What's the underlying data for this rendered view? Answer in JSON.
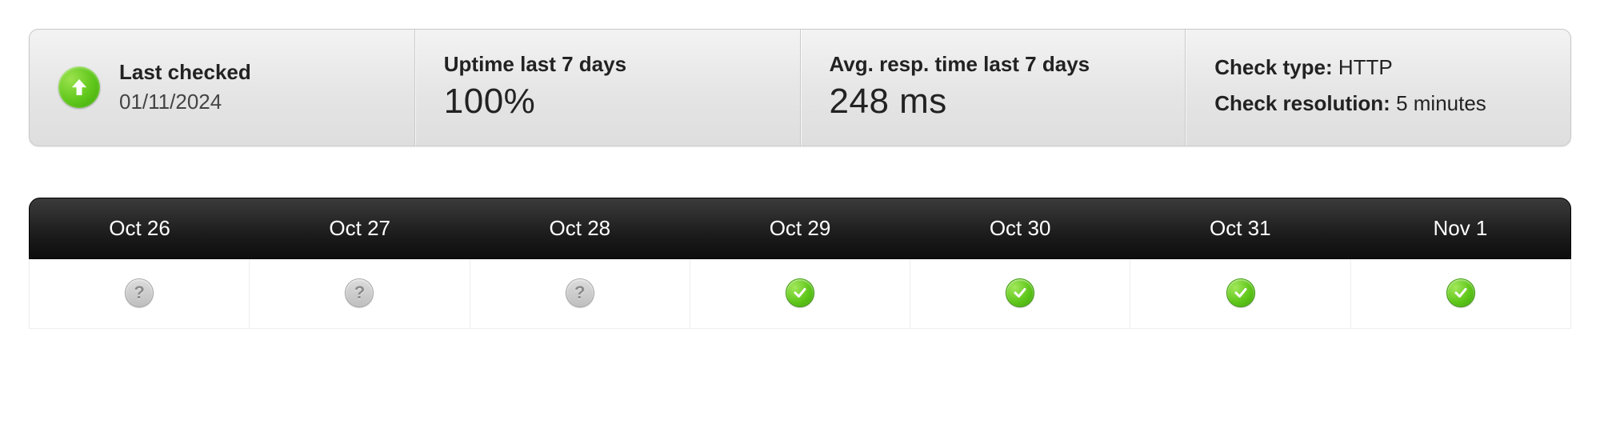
{
  "summary": {
    "last_checked_label": "Last checked",
    "last_checked_value": "01/11/2024",
    "uptime_label": "Uptime last 7 days",
    "uptime_value": "100%",
    "resp_label": "Avg. resp. time last 7 days",
    "resp_value": "248 ms",
    "check_type_label": "Check type:",
    "check_type_value": "HTTP",
    "check_res_label": "Check resolution:",
    "check_res_value": "5 minutes",
    "status_icon": "up-arrow-icon"
  },
  "history": {
    "days": [
      {
        "label": "Oct 26",
        "status": "unknown"
      },
      {
        "label": "Oct 27",
        "status": "unknown"
      },
      {
        "label": "Oct 28",
        "status": "unknown"
      },
      {
        "label": "Oct 29",
        "status": "ok"
      },
      {
        "label": "Oct 30",
        "status": "ok"
      },
      {
        "label": "Oct 31",
        "status": "ok"
      },
      {
        "label": "Nov 1",
        "status": "ok"
      }
    ]
  }
}
